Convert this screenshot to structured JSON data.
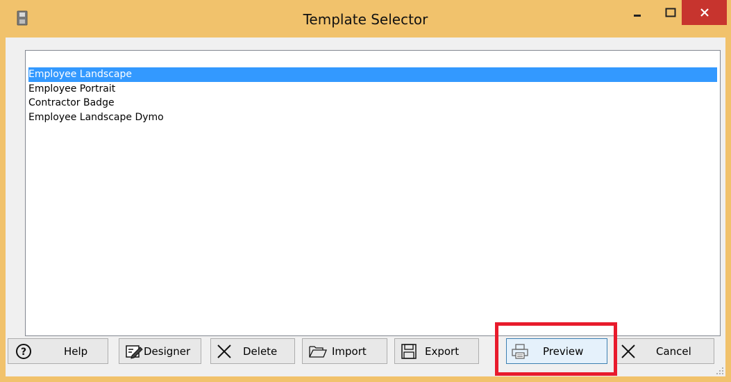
{
  "window": {
    "title": "Template Selector",
    "icon": "floppy-disk-icon",
    "controls": [
      "minimize-icon",
      "maximize-icon",
      "close-icon"
    ]
  },
  "templates": [
    {
      "label": "Employee Landscape",
      "selected": true
    },
    {
      "label": "Employee Portrait",
      "selected": false
    },
    {
      "label": "Contractor Badge",
      "selected": false
    },
    {
      "label": "Employee Landscape Dymo",
      "selected": false
    }
  ],
  "buttons": {
    "help": {
      "label": "Help",
      "icon": "question-circle-icon"
    },
    "designer": {
      "label": "Designer",
      "icon": "edit-form-icon"
    },
    "delete": {
      "label": "Delete",
      "icon": "x-mark-icon"
    },
    "import": {
      "label": "Import",
      "icon": "folder-open-icon"
    },
    "export": {
      "label": "Export",
      "icon": "floppy-save-icon"
    },
    "preview": {
      "label": "Preview",
      "icon": "printer-icon"
    },
    "cancel": {
      "label": "Cancel",
      "icon": "x-mark-icon"
    }
  },
  "colors": {
    "titlebar": "#f1c26c",
    "close_button": "#c7342e",
    "selection": "#3399ff",
    "highlight_box": "#e81b2c"
  }
}
